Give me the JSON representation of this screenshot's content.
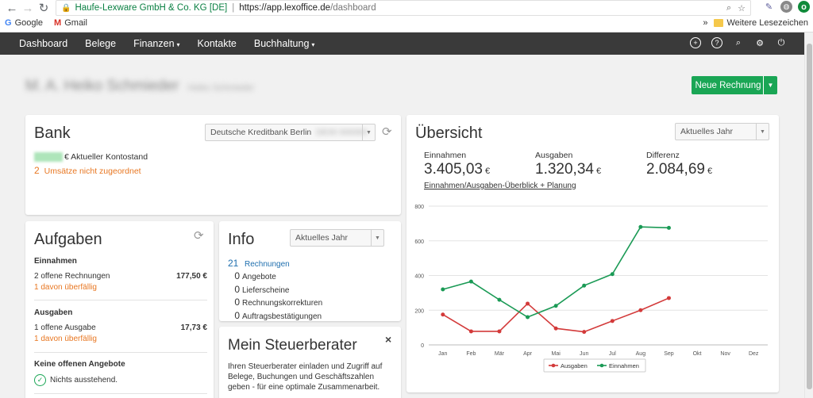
{
  "browser": {
    "secure_label": "Haufe-Lexware GmbH & Co. KG [DE]",
    "url_host": "https://app.lexoffice.de",
    "url_path": "/dashboard",
    "bookmarks": [
      "Google",
      "Gmail"
    ],
    "other_bookmarks": "Weitere Lesezeichen",
    "overflow": "»"
  },
  "nav": {
    "items": [
      "Dashboard",
      "Belege",
      "Finanzen",
      "Kontakte",
      "Buchhaltung"
    ],
    "dropdown_caret": "▾"
  },
  "header": {
    "company": "M. A. Heiko Schmieder",
    "subtitle": "Heiko Schmieder",
    "new_invoice_label": "Neue Rechnung"
  },
  "bank": {
    "title": "Bank",
    "account_select": "Deutsche Kreditbank Berlin",
    "account_number": "DE00 000000",
    "balance_label": "€ Aktueller Kontostand",
    "unassigned_count": "2",
    "unassigned_label": "Umsätze nicht zugeordnet"
  },
  "tasks": {
    "title": "Aufgaben",
    "income": {
      "title": "Einnahmen",
      "row_label": "2  offene Rechnungen",
      "row_amount": "177,50 €",
      "overdue": "1  davon überfällig"
    },
    "expenses": {
      "title": "Ausgaben",
      "row_label": "1  offene Ausgabe",
      "row_amount": "17,73 €",
      "overdue": "1  davon überfällig"
    },
    "offers": {
      "title": "Keine offenen Angebote",
      "status": "Nichts ausstehend."
    }
  },
  "info": {
    "title": "Info",
    "period": "Aktuelles Jahr",
    "items": [
      {
        "count": "21",
        "label": "Rechnungen"
      },
      {
        "count": "0",
        "label": "Angebote"
      },
      {
        "count": "0",
        "label": "Lieferscheine"
      },
      {
        "count": "0",
        "label": "Rechnungskorrekturen"
      },
      {
        "count": "0",
        "label": "Auftragsbestätigungen"
      }
    ]
  },
  "tax_advisor": {
    "title": "Mein Steuerberater",
    "close": "×",
    "text": "Ihren Steuerberater einladen und Zugriff auf Belege, Buchungen und Geschäftszahlen geben - für eine optimale Zusammenarbeit."
  },
  "overview": {
    "title": "Übersicht",
    "period": "Aktuelles Jahr",
    "income_label": "Einnahmen",
    "income_value": "3.405,03",
    "expenses_label": "Ausgaben",
    "expenses_value": "1.320,34",
    "difference_label": "Differenz",
    "difference_value": "2.084,69",
    "currency": "€",
    "link": "Einnahmen/Ausgaben-Überblick + Planung"
  },
  "chart_data": {
    "type": "line",
    "categories": [
      "Jan",
      "Feb",
      "Mär",
      "Apr",
      "Mai",
      "Jun",
      "Jul",
      "Aug",
      "Sep",
      "Okt",
      "Nov",
      "Dez"
    ],
    "ylim": [
      0,
      800
    ],
    "yticks": [
      0,
      200,
      400,
      600,
      800
    ],
    "grid": true,
    "legend_position": "bottom",
    "series": [
      {
        "name": "Ausgaben",
        "color": "#d33a3a",
        "values": [
          175,
          78,
          78,
          238,
          95,
          75,
          138,
          200,
          270,
          null,
          null,
          null
        ]
      },
      {
        "name": "Einnahmen",
        "color": "#1a9a55",
        "values": [
          320,
          365,
          260,
          160,
          225,
          342,
          408,
          680,
          675,
          null,
          null,
          null
        ]
      }
    ]
  }
}
